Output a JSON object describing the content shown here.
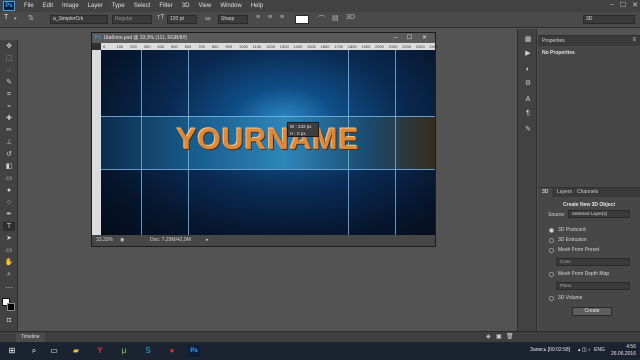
{
  "app": {
    "logo": "Ps"
  },
  "menu": [
    "File",
    "Edit",
    "Image",
    "Layer",
    "Type",
    "Select",
    "Filter",
    "3D",
    "View",
    "Window",
    "Help"
  ],
  "window_controls": [
    "–",
    "☐",
    "✕"
  ],
  "options": {
    "font_family": "a_SimplerCrk",
    "font_style": "Regular",
    "font_size": "120 pt",
    "aa_label": "aa",
    "anti_alias": "Sharp",
    "workspace": "3D"
  },
  "document": {
    "tab_title": "Шаблон.psd @ 33,3% (111, RGB/8#)",
    "zoom": "33,33%",
    "doc_size": "Doc: 7,29M/42,9M",
    "ruler_marks": [
      "0",
      "100",
      "200",
      "300",
      "400",
      "500",
      "600",
      "700",
      "800",
      "900",
      "1000",
      "1100",
      "1200",
      "1300",
      "1400",
      "1500",
      "1600",
      "1700",
      "1800",
      "1900",
      "2000",
      "2100",
      "2200",
      "2300",
      "2400"
    ],
    "canvas_text": "YOURNAME",
    "size_tip": {
      "w_label": "W :",
      "w_value": "432 px",
      "h_label": "H :",
      "h_value": "0 px"
    }
  },
  "properties_panel": {
    "title": "Properties",
    "empty_text": "No Properties"
  },
  "panel_3d": {
    "tabs": [
      "3D",
      "Layers",
      "Channels"
    ],
    "heading": "Create New 3D Object",
    "source_label": "Source:",
    "source_value": "Selected Layer(s)",
    "options": [
      {
        "label": "3D Postcard",
        "selected": true
      },
      {
        "label": "3D Extrusion",
        "selected": false
      },
      {
        "label": "Mesh From Preset",
        "selected": false
      },
      {
        "label": "Mesh From Depth Map",
        "selected": false
      },
      {
        "label": "3D Volume",
        "selected": false
      }
    ],
    "preset_dropdown": "Cone",
    "depth_dropdown": "Plane",
    "create_button": "Create"
  },
  "bottom": {
    "timeline_tab": "Timeline"
  },
  "taskbar": {
    "recording": "Запись [00:02:58]",
    "language": "ENG",
    "time": "4:56",
    "date": "26.06.2016"
  },
  "colors": {
    "accent": "#31a8ff",
    "ps_blue": "#0b1f3a",
    "title_orange": "#d98a3e"
  }
}
